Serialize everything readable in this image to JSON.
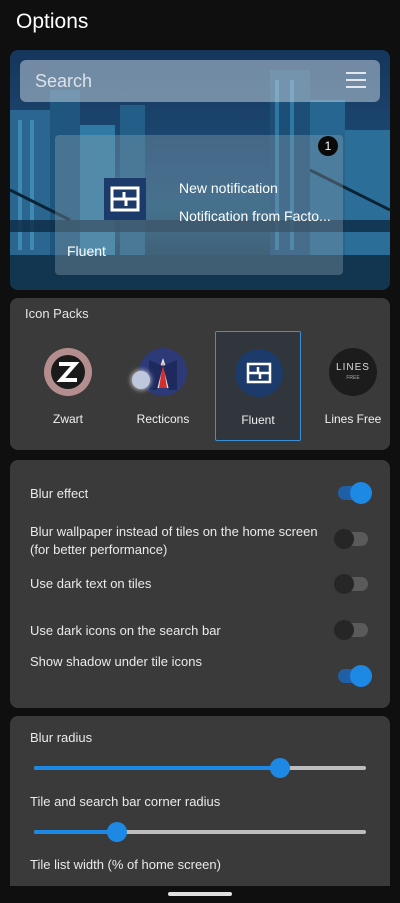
{
  "header": {
    "title": "Options"
  },
  "preview": {
    "search_placeholder": "Search",
    "notification": {
      "badge": "1",
      "title": "New notification",
      "body": "Notification from Facto...",
      "tile_label": "Fluent"
    }
  },
  "icon_packs": {
    "title": "Icon Packs",
    "items": [
      {
        "label": "Zwart",
        "selected": false
      },
      {
        "label": "Recticons",
        "selected": false
      },
      {
        "label": "Fluent",
        "selected": true
      },
      {
        "label": "Lines Free",
        "selected": false
      }
    ],
    "lines_badge_text": "LINES",
    "lines_badge_sub": "FREE"
  },
  "toggles": [
    {
      "label": "Blur effect",
      "on": true
    },
    {
      "label": "Blur wallpaper instead of tiles on the home screen (for better performance)",
      "on": false
    },
    {
      "label": "Use dark text on tiles",
      "on": false
    },
    {
      "label": "Use dark icons on the search bar",
      "on": false
    },
    {
      "label": "Show shadow under tile icons",
      "on": true
    }
  ],
  "sliders": [
    {
      "label": "Blur radius",
      "value": 0.74
    },
    {
      "label": "Tile and search bar corner radius",
      "value": 0.25
    },
    {
      "label": "Tile list width (% of home screen)"
    }
  ],
  "colors": {
    "accent": "#1e88e5",
    "card": "#3a3a3a",
    "background": "#0f0f0f"
  }
}
